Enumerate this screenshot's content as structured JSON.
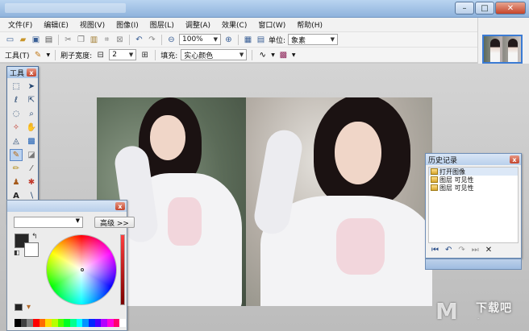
{
  "menu": [
    "文件(F)",
    "编辑(E)",
    "视图(V)",
    "图像(I)",
    "图层(L)",
    "调整(A)",
    "效果(C)",
    "窗口(W)",
    "帮助(H)"
  ],
  "toolbar1": {
    "zoom_value": "100%",
    "unit_label": "单位:",
    "unit_value": "象素"
  },
  "toolbar2": {
    "tool_label": "工具(T)",
    "brush_width_label": "刷子宽度:",
    "brush_width_value": "2",
    "fill_label": "填充:",
    "fill_value": "实心颜色"
  },
  "tools_panel": {
    "title": "工具",
    "tools": [
      "rectangle-select",
      "move-selection",
      "lasso-select",
      "move-selected",
      "ellipse-select",
      "zoom",
      "magic-wand",
      "pan",
      "paint-bucket",
      "gradient",
      "paintbrush",
      "eraser",
      "pencil",
      "color-picker",
      "clone-stamp",
      "recolor",
      "text",
      "line-curve",
      "rectangle",
      "rounded-rectangle",
      "ellipse",
      "freeform-shape"
    ]
  },
  "colors_panel": {
    "advanced_button": "高级 >>",
    "primary_color": "#262626",
    "secondary_color": "#ffffff",
    "palette": [
      "#000000",
      "#404040",
      "#808080",
      "#ff0000",
      "#ff6a00",
      "#ffd800",
      "#b6ff00",
      "#4cff00",
      "#00ff21",
      "#00ff90",
      "#00ffff",
      "#0094ff",
      "#0026ff",
      "#4800ff",
      "#b200ff",
      "#ff00dc",
      "#ff006e",
      "#ffffff"
    ]
  },
  "history_panel": {
    "title": "历史记录",
    "items": [
      "打开图像",
      "图层 可见性",
      "图层 可见性"
    ]
  },
  "watermark": {
    "text": "下载吧"
  }
}
